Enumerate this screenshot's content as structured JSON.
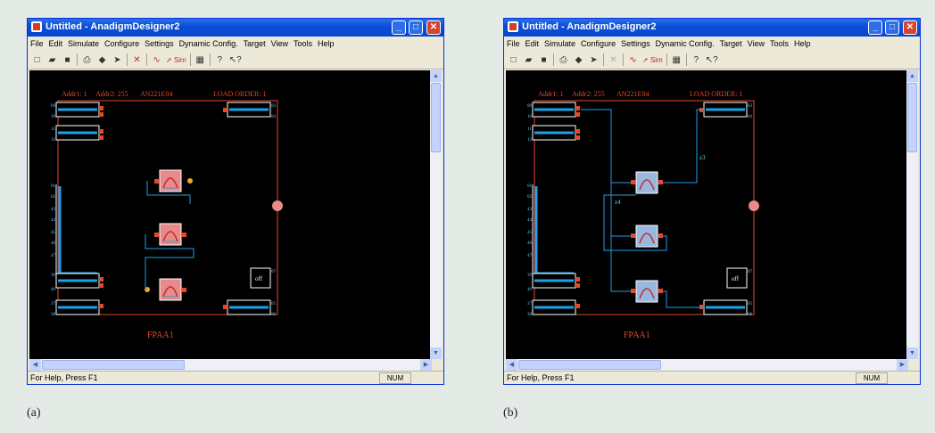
{
  "windows": [
    {
      "title": "Untitled - AnadigmDesigner2",
      "caption": "(a)",
      "highlight": "#e88a8a"
    },
    {
      "title": "Untitled - AnadigmDesigner2",
      "caption": "(b)",
      "highlight": "#9ab7e0"
    }
  ],
  "menu": [
    "File",
    "Edit",
    "Simulate",
    "Configure",
    "Settings",
    "Dynamic Config.",
    "Target",
    "View",
    "Tools",
    "Help"
  ],
  "toolbar": {
    "icons": [
      "new-icon",
      "open-icon",
      "save-icon",
      "print-icon",
      "camera-icon",
      "probe-icon",
      "delete-icon",
      "wave-icon",
      "sim-icon",
      "chip-icon",
      "help-icon",
      "context-help-icon"
    ],
    "sim_label": "Sim"
  },
  "canvas": {
    "header": {
      "addr1": "Addr1: 1",
      "addr2": "Addr2: 255",
      "chip": "AN221E04",
      "load_order": "LOAD ORDER: 1"
    },
    "chip_label": "FPAA1",
    "off_label": "off",
    "wire_labels": {
      "n1": "z3",
      "n2": "z4"
    },
    "pins_left": [
      "09",
      "10",
      "11",
      "12",
      "01",
      "02",
      "43",
      "44",
      "45",
      "46",
      "47",
      "48",
      "39",
      "40",
      "37",
      "38"
    ],
    "pins_right": [
      "03",
      "04",
      "07",
      "05",
      "06",
      "08"
    ],
    "accent": "#e8472a",
    "wire_color": "#1fa0e8"
  },
  "status": {
    "text": "For Help, Press F1",
    "num": "NUM"
  }
}
